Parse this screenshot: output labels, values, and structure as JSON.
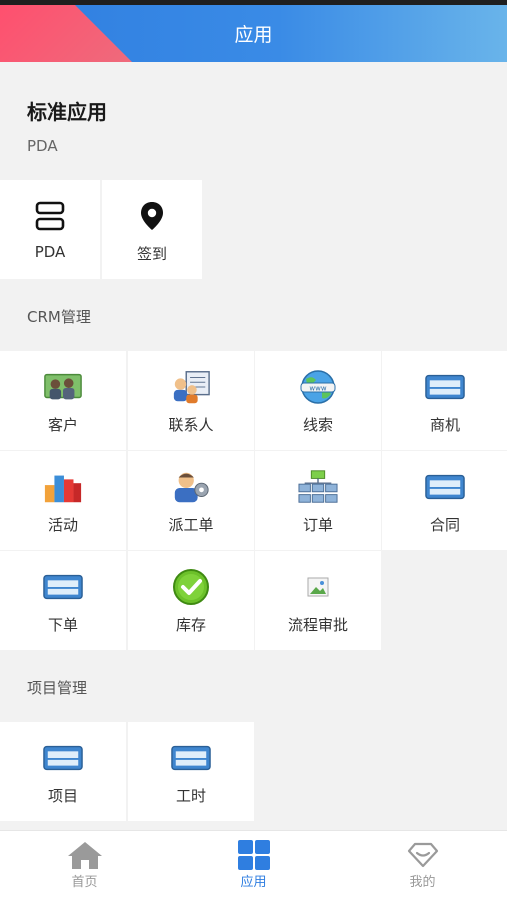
{
  "header": {
    "title": "应用"
  },
  "standard": {
    "title": "标准应用",
    "subtitle": "PDA",
    "items": [
      {
        "label": "PDA",
        "icon": "scan-icon"
      },
      {
        "label": "签到",
        "icon": "location-pin-icon"
      }
    ]
  },
  "crm": {
    "title": "CRM管理",
    "items": [
      {
        "label": "客户",
        "icon": "customer-icon"
      },
      {
        "label": "联系人",
        "icon": "contacts-icon"
      },
      {
        "label": "线索",
        "icon": "globe-icon"
      },
      {
        "label": "商机",
        "icon": "card-icon"
      },
      {
        "label": "活动",
        "icon": "bar-chart-icon"
      },
      {
        "label": "派工单",
        "icon": "worker-icon"
      },
      {
        "label": "订单",
        "icon": "org-chart-icon"
      },
      {
        "label": "合同",
        "icon": "card-icon"
      },
      {
        "label": "下单",
        "icon": "card-icon"
      },
      {
        "label": "库存",
        "icon": "check-circle-icon"
      },
      {
        "label": "流程审批",
        "icon": "image-placeholder-icon"
      }
    ]
  },
  "project": {
    "title": "项目管理",
    "items": [
      {
        "label": "项目",
        "icon": "card-icon"
      },
      {
        "label": "工时",
        "icon": "card-icon"
      }
    ]
  },
  "bottom_nav": [
    {
      "label": "首页",
      "icon": "home-icon"
    },
    {
      "label": "应用",
      "icon": "apps-icon",
      "active": true
    },
    {
      "label": "我的",
      "icon": "profile-diamond-icon"
    }
  ],
  "colors": {
    "accent": "#2f7ee0",
    "header_red": "#ff4f6e"
  }
}
